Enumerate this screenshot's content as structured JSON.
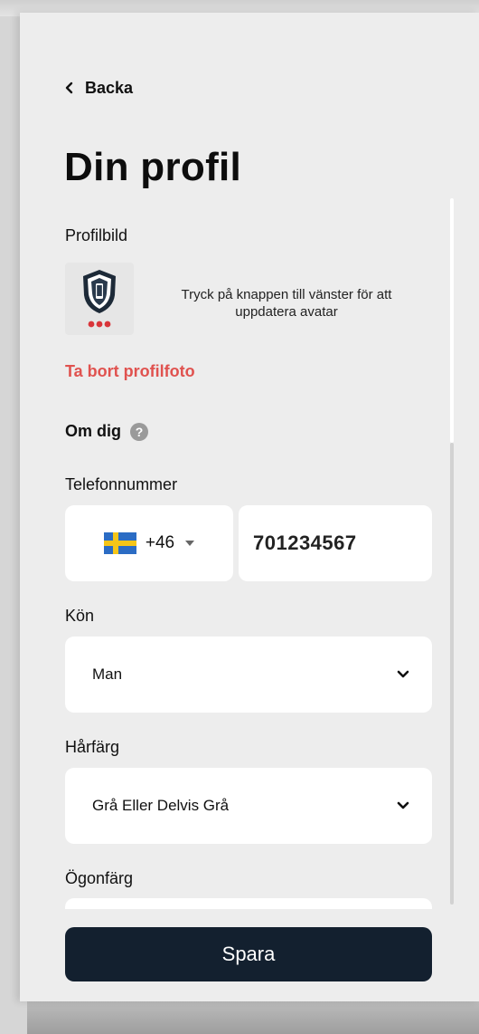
{
  "nav": {
    "back_label": "Backa"
  },
  "page": {
    "title": "Din profil"
  },
  "profile_picture": {
    "label": "Profilbild",
    "hint": "Tryck på knappen till vänster för att uppdatera avatar",
    "remove_label": "Ta bort profilfoto",
    "avatar_icon": "shield-phone-icon"
  },
  "about": {
    "label": "Om dig",
    "help_icon": "question-circle-icon",
    "help_glyph": "?"
  },
  "phone": {
    "label": "Telefonnummer",
    "country_flag": "sweden-flag-icon",
    "country_code": "+46",
    "number": "701234567"
  },
  "gender": {
    "label": "Kön",
    "value": "Man"
  },
  "hair_color": {
    "label": "Hårfärg",
    "value": "Grå Eller Delvis Grå"
  },
  "eye_color": {
    "label": "Ögonfärg"
  },
  "actions": {
    "save_label": "Spara"
  },
  "colors": {
    "background": "#ededed",
    "field": "#ffffff",
    "danger": "#e0524f",
    "primary_button": "#13202f",
    "flag_blue": "#2b6cc4",
    "flag_yellow": "#f5c518"
  }
}
